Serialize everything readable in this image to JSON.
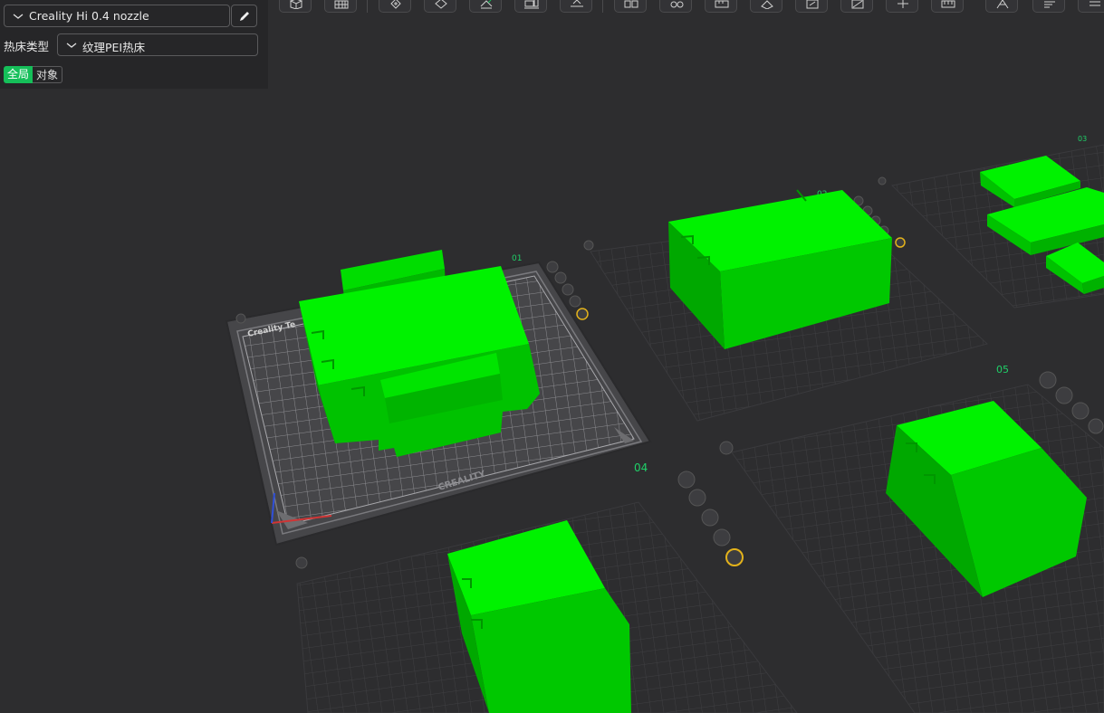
{
  "settings": {
    "printer_preset": "Creality Hi 0.4 nozzle",
    "bed_type_label": "热床类型",
    "bed_type_value": "纹理PEI热床",
    "scope_tabs": [
      "全局",
      "对象"
    ],
    "active_scope": "全局"
  },
  "toolbar": {
    "icons": [
      "view-cube-icon",
      "grid-icon",
      "add-model-icon",
      "orient-icon",
      "auto-arrange-icon",
      "plate-icon",
      "lay-on-face-icon",
      "split-objects-icon",
      "split-parts-icon",
      "measure-icon",
      "support-paint-icon",
      "seam-paint-icon",
      "color-paint-icon",
      "cut-icon",
      "assembly-icon",
      "text-emboss-icon",
      "variable-layer-icon",
      "more-icon"
    ]
  },
  "viewport": {
    "plates": [
      {
        "number": "01",
        "selected": true,
        "brand_text": "CREALITY",
        "tag_text": "Creality Te"
      },
      {
        "number": "02",
        "selected": false
      },
      {
        "number": "03",
        "selected": false
      },
      {
        "number": "04",
        "selected": false
      },
      {
        "number": "05",
        "selected": false
      }
    ],
    "model_color": "#00ff00",
    "active_plate_color": "#8e8e92",
    "idle_grid_color": "#3d3d40",
    "accent_color": "#15bf59",
    "settings_icon_color": "#e3b21b"
  }
}
